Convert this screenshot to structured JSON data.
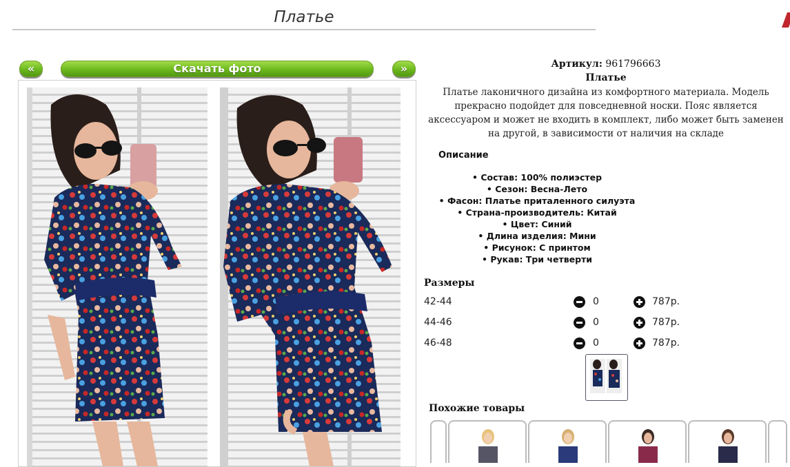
{
  "page_title": "Платье",
  "nav": {
    "prev_label": "«",
    "download_label": "Скачать фото",
    "next_label": "»"
  },
  "product": {
    "article_label": "Артикул:",
    "article_value": "961796663",
    "name": "Платье",
    "description": "Платье лаконичного дизайна из комфортного материала. Модель прекрасно подойдет для повседневной носки. Пояс является аксессуаром и может не входить в комплект, либо может быть заменен на другой, в зависимости от наличия на складе"
  },
  "specs": {
    "heading": "Описание",
    "items": [
      "Состав: 100% полиэстер",
      "Сезон: Весна-Лето",
      "Фасон: Платье приталенного силуэта",
      "Страна-производитель: Китай",
      "Цвет: Синий",
      "Длина изделия: Мини",
      "Рисунок: С принтом",
      "Рукав: Три четверти"
    ]
  },
  "sizes": {
    "heading": "Размеры",
    "rows": [
      {
        "size": "42-44",
        "qty": "0",
        "price": "787р."
      },
      {
        "size": "44-46",
        "qty": "0",
        "price": "787р."
      },
      {
        "size": "46-48",
        "qty": "0",
        "price": "787р."
      }
    ]
  },
  "similar": {
    "heading": "Похожие товары"
  },
  "colors": {
    "button_green": "#6cb81d",
    "dress_navy": "#1a2a5a",
    "belt": "#1c2c6a"
  }
}
